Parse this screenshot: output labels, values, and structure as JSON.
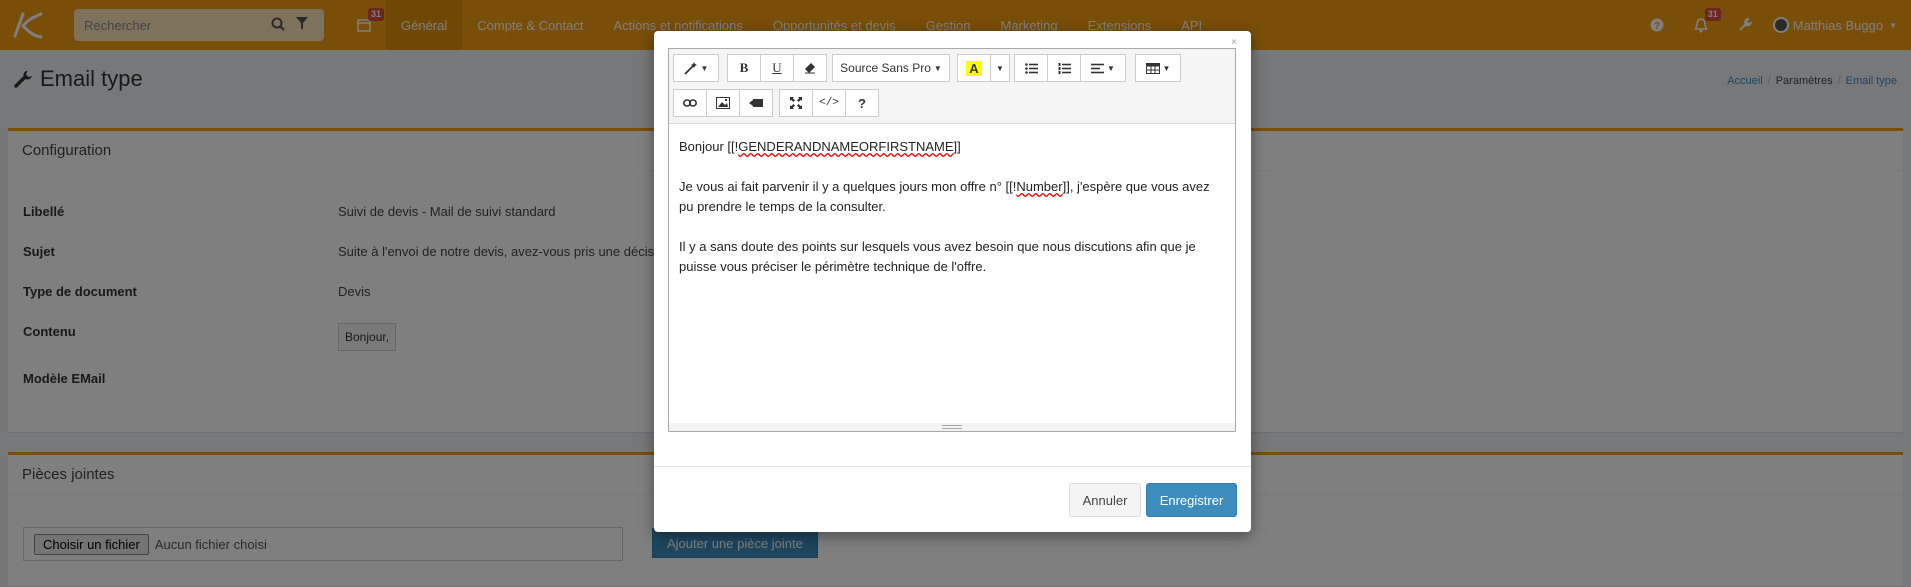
{
  "navbar": {
    "search_placeholder": "Rechercher",
    "calendar_badge": "31",
    "menu": [
      "Général",
      "Compte & Contact",
      "Actions et notifications",
      "Opportunités et devis",
      "Gestion",
      "Marketing",
      "Extensions",
      "API"
    ],
    "notif_badge": "31",
    "user_name": "Matthias Buggo"
  },
  "page": {
    "title": "Email type",
    "breadcrumb": [
      "Accueil",
      "Paramètres",
      "Email type"
    ]
  },
  "config": {
    "header": "Configuration",
    "labels": {
      "libelle": "Libellé",
      "sujet": "Sujet",
      "type_document": "Type de document",
      "contenu": "Contenu",
      "modele_email": "Modèle EMail"
    },
    "values": {
      "libelle": "Suivi de devis - Mail de suivi standard",
      "sujet": "Suite à l'envoi de notre devis, avez-vous pris une décis",
      "type_document": "Devis",
      "contenu_button": "Bonjour,"
    }
  },
  "attachments": {
    "header": "Pièces jointes",
    "file_button": "Choisir un fichier",
    "file_status": "Aucun fichier choisi",
    "add_button": "Ajouter une pièce jointe"
  },
  "modal": {
    "close": "×",
    "toolbar": {
      "font_name": "Source Sans Pro",
      "bold": "B",
      "underline": "U",
      "highlight": "A",
      "help": "?",
      "code": "</>"
    },
    "content": {
      "line1_prefix": "Bonjour [[!",
      "line1_token": "GENDERANDNAMEORFIRSTNAME",
      "line1_suffix": "]]",
      "para2_prefix": "Je vous ai fait parvenir il y a quelques jours mon offre n° [[!",
      "para2_token": "Number",
      "para2_suffix": "]], j'espère que vous avez pu prendre le temps de la consulter.",
      "para3": "Il y a sans doute des points sur lesquels vous avez besoin que nous discutions afin que je puisse vous préciser le périmètre technique de l'offre."
    },
    "cancel": "Annuler",
    "save": "Enregistrer"
  },
  "colors": {
    "navbar": "#f39c12",
    "active_tab": "#e08e0b",
    "primary": "#3c8dbc",
    "badge": "#dd4b39"
  }
}
